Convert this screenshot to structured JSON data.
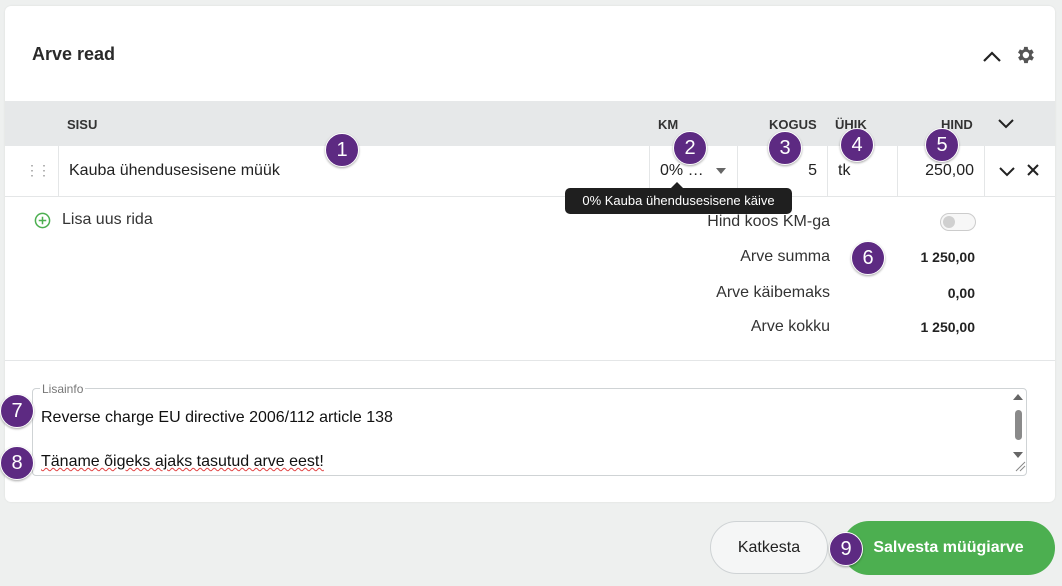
{
  "section": {
    "title": "Arve read"
  },
  "table": {
    "headers": {
      "sisu": "SISU",
      "km": "KM",
      "kogus": "KOGUS",
      "uhik": "ÜHIK",
      "hind": "HIND"
    },
    "rows": [
      {
        "sisu": "Kauba ühendusesisene müük",
        "km": "0% …",
        "kogus": "5",
        "uhik": "tk",
        "hind": "250,00"
      }
    ],
    "tooltip": "0% Kauba ühendusesisene käive"
  },
  "add_row": {
    "label": "Lisa uus rida"
  },
  "totals": {
    "price_with_vat_label": "Hind koos KM-ga",
    "price_with_vat_on": false,
    "sum_label": "Arve summa",
    "sum_value": "1 250,00",
    "vat_label": "Arve käibemaks",
    "vat_value": "0,00",
    "total_label": "Arve kokku",
    "total_value": "1 250,00"
  },
  "lisainfo": {
    "label": "Lisainfo",
    "line1": "Reverse charge EU directive 2006/112 article 138",
    "line2": "Täname õigeks ajaks tasutud arve eest!"
  },
  "buttons": {
    "cancel": "Katkesta",
    "save": "Salvesta müügiarve"
  },
  "badges": [
    "1",
    "2",
    "3",
    "4",
    "5",
    "6",
    "7",
    "8",
    "9"
  ],
  "colors": {
    "accent": "#4caf50",
    "badge": "#5d2a82"
  }
}
